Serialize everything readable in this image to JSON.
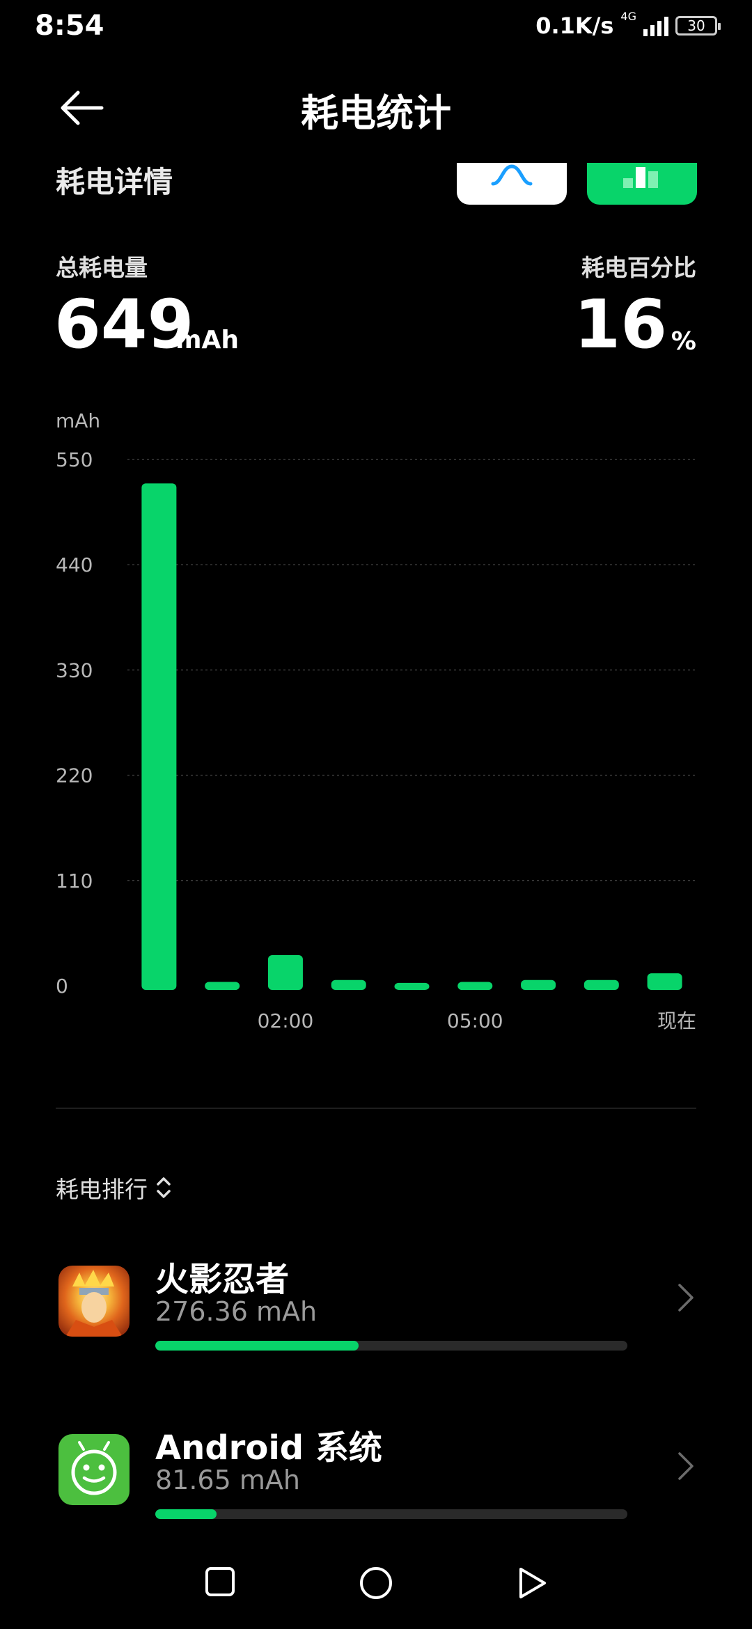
{
  "status_bar": {
    "time": "8:54",
    "net_speed": "0.1K/s",
    "net_type": "4G",
    "battery": "30"
  },
  "header": {
    "title": "耗电统计",
    "back_icon": "back-arrow-icon"
  },
  "details": {
    "title": "耗电详情",
    "toggle_line_icon": "line-chart-icon",
    "toggle_bar_icon": "bar-chart-icon",
    "total_label": "总耗电量",
    "total_value": "649",
    "total_unit": "mAh",
    "percent_label": "耗电百分比",
    "percent_value": "16",
    "percent_unit": "%"
  },
  "chart_data": {
    "type": "bar",
    "ylabel": "mAh",
    "ylim": [
      0,
      550
    ],
    "yticks": [
      "550",
      "440",
      "330",
      "220",
      "110",
      "0"
    ],
    "x_tick_labels": [
      "02:00",
      "05:00",
      "现在"
    ],
    "values": [
      525,
      4,
      32,
      6,
      3,
      4,
      6,
      6,
      13
    ],
    "grid": true,
    "colors": {
      "bar": "#08d46a"
    }
  },
  "ranking": {
    "label": "耗电排行",
    "sort_icon": "sort-updown-icon",
    "items": [
      {
        "name": "火影忍者",
        "usage": "276.36 mAh",
        "fraction": 0.43,
        "icon": "naruto-app-icon"
      },
      {
        "name": "Android 系统",
        "usage": "81.65 mAh",
        "fraction": 0.13,
        "icon": "android-app-icon"
      }
    ]
  },
  "nav_bar": {
    "recent_icon": "square-recents-icon",
    "home_icon": "circle-home-icon",
    "back_icon": "triangle-back-icon"
  },
  "colors": {
    "accent": "#08d46a",
    "background": "#000000",
    "line_icon": "#1a9fff"
  }
}
